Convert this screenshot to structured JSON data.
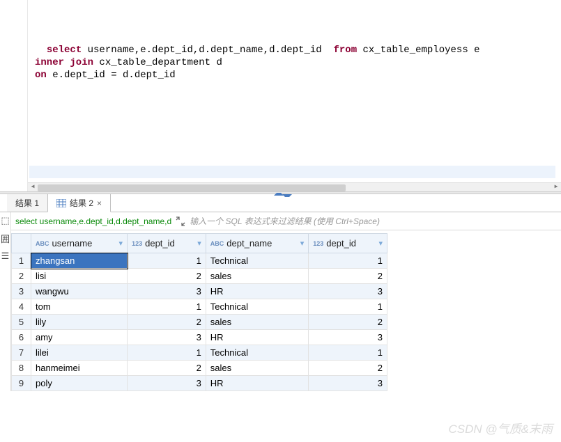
{
  "sql": {
    "tokens": [
      {
        "t": "select ",
        "k": true
      },
      {
        "t": "username,e.dept_id,d.dept_name,d.dept_id  "
      },
      {
        "t": "from ",
        "k": true
      },
      {
        "t": "cx_table_employess e"
      },
      {
        "nl": true
      },
      {
        "t": "inner join ",
        "k": true
      },
      {
        "t": "cx_table_department d"
      },
      {
        "nl": true
      },
      {
        "t": "on ",
        "k": true
      },
      {
        "t": "e.dept_id = d.dept_id"
      }
    ]
  },
  "tabs": {
    "t1": "结果 1",
    "t2": "结果 2",
    "close": "×"
  },
  "filter": {
    "query_text": "select username,e.dept_id,d.dept_name,d",
    "placeholder": "输入一个 SQL 表达式来过滤结果 (使用 Ctrl+Space)"
  },
  "left_tools": [
    "⬚",
    "囲",
    "☰"
  ],
  "columns": [
    {
      "name": "username",
      "type": "ABC"
    },
    {
      "name": "dept_id",
      "type": "123"
    },
    {
      "name": "dept_name",
      "type": "ABC"
    },
    {
      "name": "dept_id",
      "type": "123"
    }
  ],
  "rows": [
    {
      "n": "1",
      "c": [
        "zhangsan",
        "1",
        "Technical",
        "1"
      ]
    },
    {
      "n": "2",
      "c": [
        "lisi",
        "2",
        "sales",
        "2"
      ]
    },
    {
      "n": "3",
      "c": [
        "wangwu",
        "3",
        "HR",
        "3"
      ]
    },
    {
      "n": "4",
      "c": [
        "tom",
        "1",
        "Technical",
        "1"
      ]
    },
    {
      "n": "5",
      "c": [
        "lily",
        "2",
        "sales",
        "2"
      ]
    },
    {
      "n": "6",
      "c": [
        "amy",
        "3",
        "HR",
        "3"
      ]
    },
    {
      "n": "7",
      "c": [
        "lilei",
        "1",
        "Technical",
        "1"
      ]
    },
    {
      "n": "8",
      "c": [
        "hanmeimei",
        "2",
        "sales",
        "2"
      ]
    },
    {
      "n": "9",
      "c": [
        "poly",
        "3",
        "HR",
        "3"
      ]
    }
  ],
  "chart_data": {
    "type": "table",
    "columns": [
      "username",
      "dept_id",
      "dept_name",
      "dept_id"
    ],
    "data": [
      [
        "zhangsan",
        1,
        "Technical",
        1
      ],
      [
        "lisi",
        2,
        "sales",
        2
      ],
      [
        "wangwu",
        3,
        "HR",
        3
      ],
      [
        "tom",
        1,
        "Technical",
        1
      ],
      [
        "lily",
        2,
        "sales",
        2
      ],
      [
        "amy",
        3,
        "HR",
        3
      ],
      [
        "lilei",
        1,
        "Technical",
        1
      ],
      [
        "hanmeimei",
        2,
        "sales",
        2
      ],
      [
        "poly",
        3,
        "HR",
        3
      ]
    ]
  },
  "watermark": "CSDN @气质&末雨"
}
